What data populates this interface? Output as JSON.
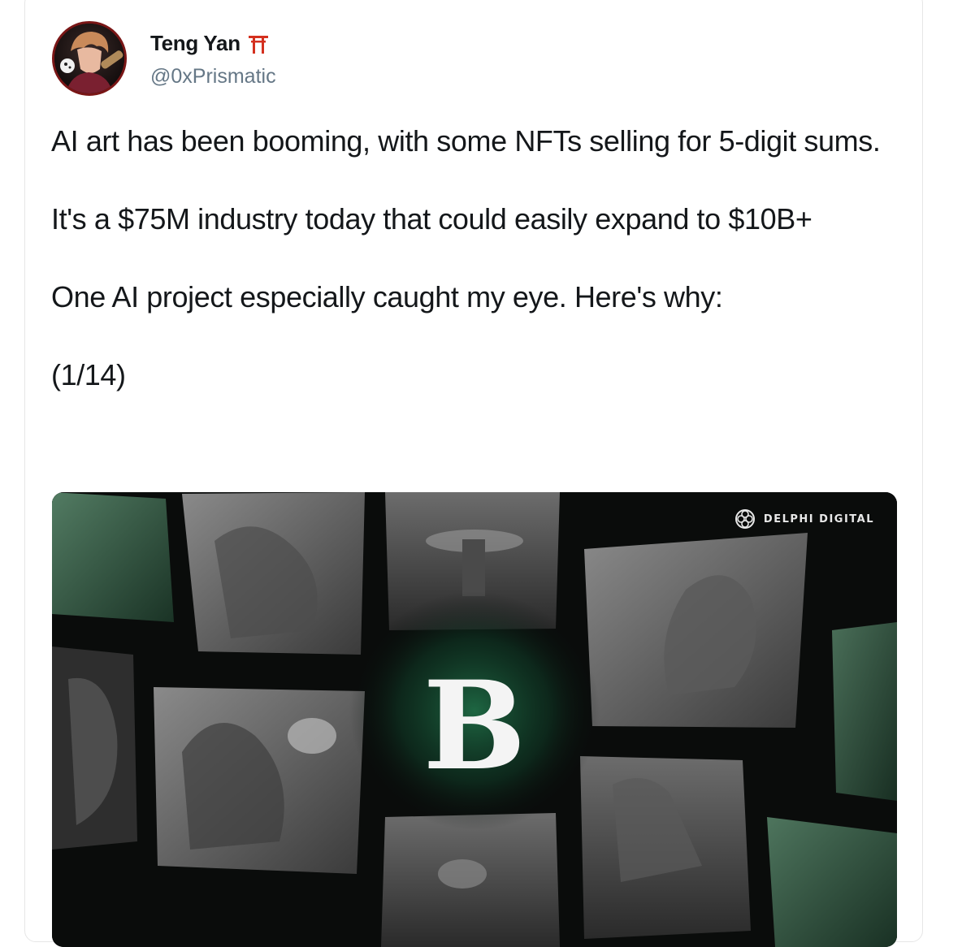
{
  "author": {
    "name": "Teng Yan",
    "emoji_icon": "torii-gate-icon",
    "handle": "@0xPrismatic"
  },
  "tweet": {
    "paragraphs": [
      "AI art has been booming, with some NFTs selling for 5-digit sums.",
      "It's a $75M industry today that could easily expand to $10B+",
      "One AI project especially caught my eye. Here's why:",
      "(1/14)"
    ]
  },
  "media": {
    "center_letter": "B",
    "watermark": "DELPHI DIGITAL",
    "accent_color": "#1f6b45"
  }
}
